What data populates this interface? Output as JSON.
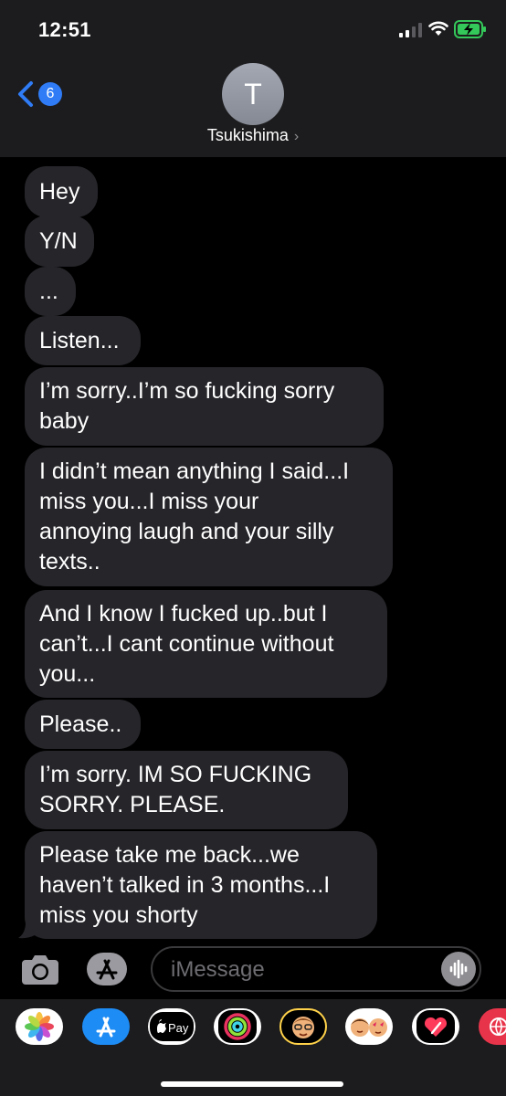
{
  "status": {
    "time": "12:51"
  },
  "header": {
    "back_count": "6",
    "avatar_initial": "T",
    "contact_name": "Tsukishima"
  },
  "messages": [
    "Hey",
    "Y/N",
    "...",
    "Listen...",
    [
      "I’m sorry..I’m so fucking sorry",
      "baby"
    ],
    [
      "I didn’t mean anything I said...I",
      "miss you...I miss your",
      "annoying laugh and your silly",
      "texts.."
    ],
    [
      "And I know I fucked up..but I",
      "can’t...I cant continue without",
      "you..."
    ],
    "Please..",
    [
      "I’m sorry. IM SO FUCKING",
      "SORRY. PLEASE."
    ],
    [
      "Please take me back...we",
      "haven’t talked in 3 months...I",
      "miss you shorty"
    ]
  ],
  "input": {
    "placeholder": "iMessage"
  },
  "apps": [
    {
      "icon": "photos-icon"
    },
    {
      "icon": "app-store-icon"
    },
    {
      "icon": "apple-pay-icon",
      "label": "Pay"
    },
    {
      "icon": "activity-icon"
    },
    {
      "icon": "memoji-icon"
    },
    {
      "icon": "memoji-stickers-icon"
    },
    {
      "icon": "digital-touch-icon"
    },
    {
      "icon": "globe-icon"
    }
  ],
  "colors": {
    "bubble": "#26252a",
    "header": "#1c1c1e",
    "accent": "#2f7cf6"
  }
}
